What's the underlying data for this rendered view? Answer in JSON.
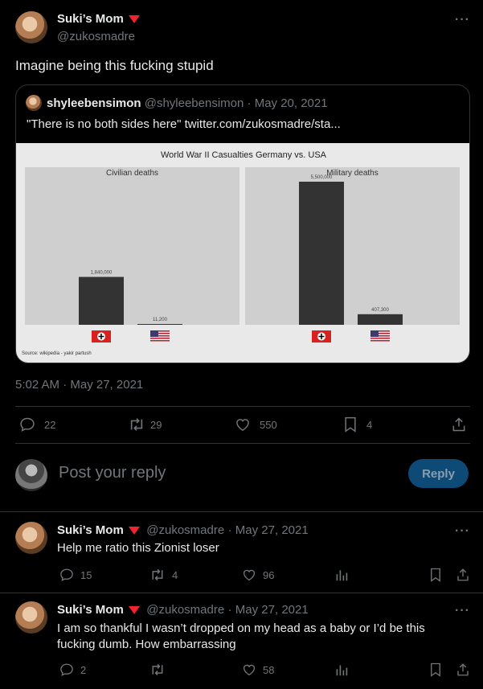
{
  "main_tweet": {
    "author_name": "Suki’s Mom",
    "author_handle": "@zukosmadre",
    "text": "Imagine being this fucking stupid",
    "timestamp": "5:02 AM · May 27, 2021",
    "stats": {
      "replies": "22",
      "retweets": "29",
      "likes": "550",
      "bookmarks": "4"
    }
  },
  "quoted_tweet": {
    "author_name": "shyleebensimon",
    "author_handle": "@shyleebensimon",
    "date": "· May 20, 2021",
    "text": "\"There is no both sides here\"  twitter.com/zukosmadre/sta..."
  },
  "composer": {
    "placeholder": "Post your reply",
    "reply_label": "Reply"
  },
  "replies": [
    {
      "author_name": "Suki’s Mom",
      "author_handle": "@zukosmadre",
      "date": "· May 27, 2021",
      "text": "Help me ratio this Zionist loser",
      "stats": {
        "replies": "15",
        "retweets": "4",
        "likes": "96"
      }
    },
    {
      "author_name": "Suki’s Mom",
      "author_handle": "@zukosmadre",
      "date": "· May 27, 2021",
      "text": "I am so thankful I wasn’t dropped on my head as a baby or I’d be this fucking dumb. How embarrassing",
      "stats": {
        "replies": "2",
        "retweets": "",
        "likes": "58"
      }
    }
  ],
  "icons": {
    "more": "more-horizontal-icon",
    "reply": "speech-bubble-icon",
    "retweet": "retweet-arrows-icon",
    "like": "heart-icon",
    "bookmark": "bookmark-icon",
    "share": "share-upload-icon",
    "views": "bar-chart-icon",
    "flag_germany": "nazi-flag-icon",
    "flag_usa": "us-flag-icon"
  },
  "colors": {
    "background": "#000000",
    "text": "#e7e9ea",
    "muted": "#71767b",
    "reply_button": "#0d4a75",
    "badge": "#f4212e"
  },
  "chart_data": {
    "type": "bar",
    "title": "World War II Casualties Germany vs. USA",
    "source": "Source: wikipedia - yakir partush",
    "categories": [
      "Germany",
      "USA"
    ],
    "panels": [
      {
        "name": "Civilian deaths",
        "values": [
          1840000,
          11200
        ],
        "labels": [
          "1,840,000",
          "11,200"
        ]
      },
      {
        "name": "Military deaths",
        "values": [
          5500000,
          407300
        ],
        "labels": [
          "5,500,000",
          "407,300"
        ]
      }
    ],
    "ylim": [
      0,
      5500000
    ],
    "grid": false
  }
}
